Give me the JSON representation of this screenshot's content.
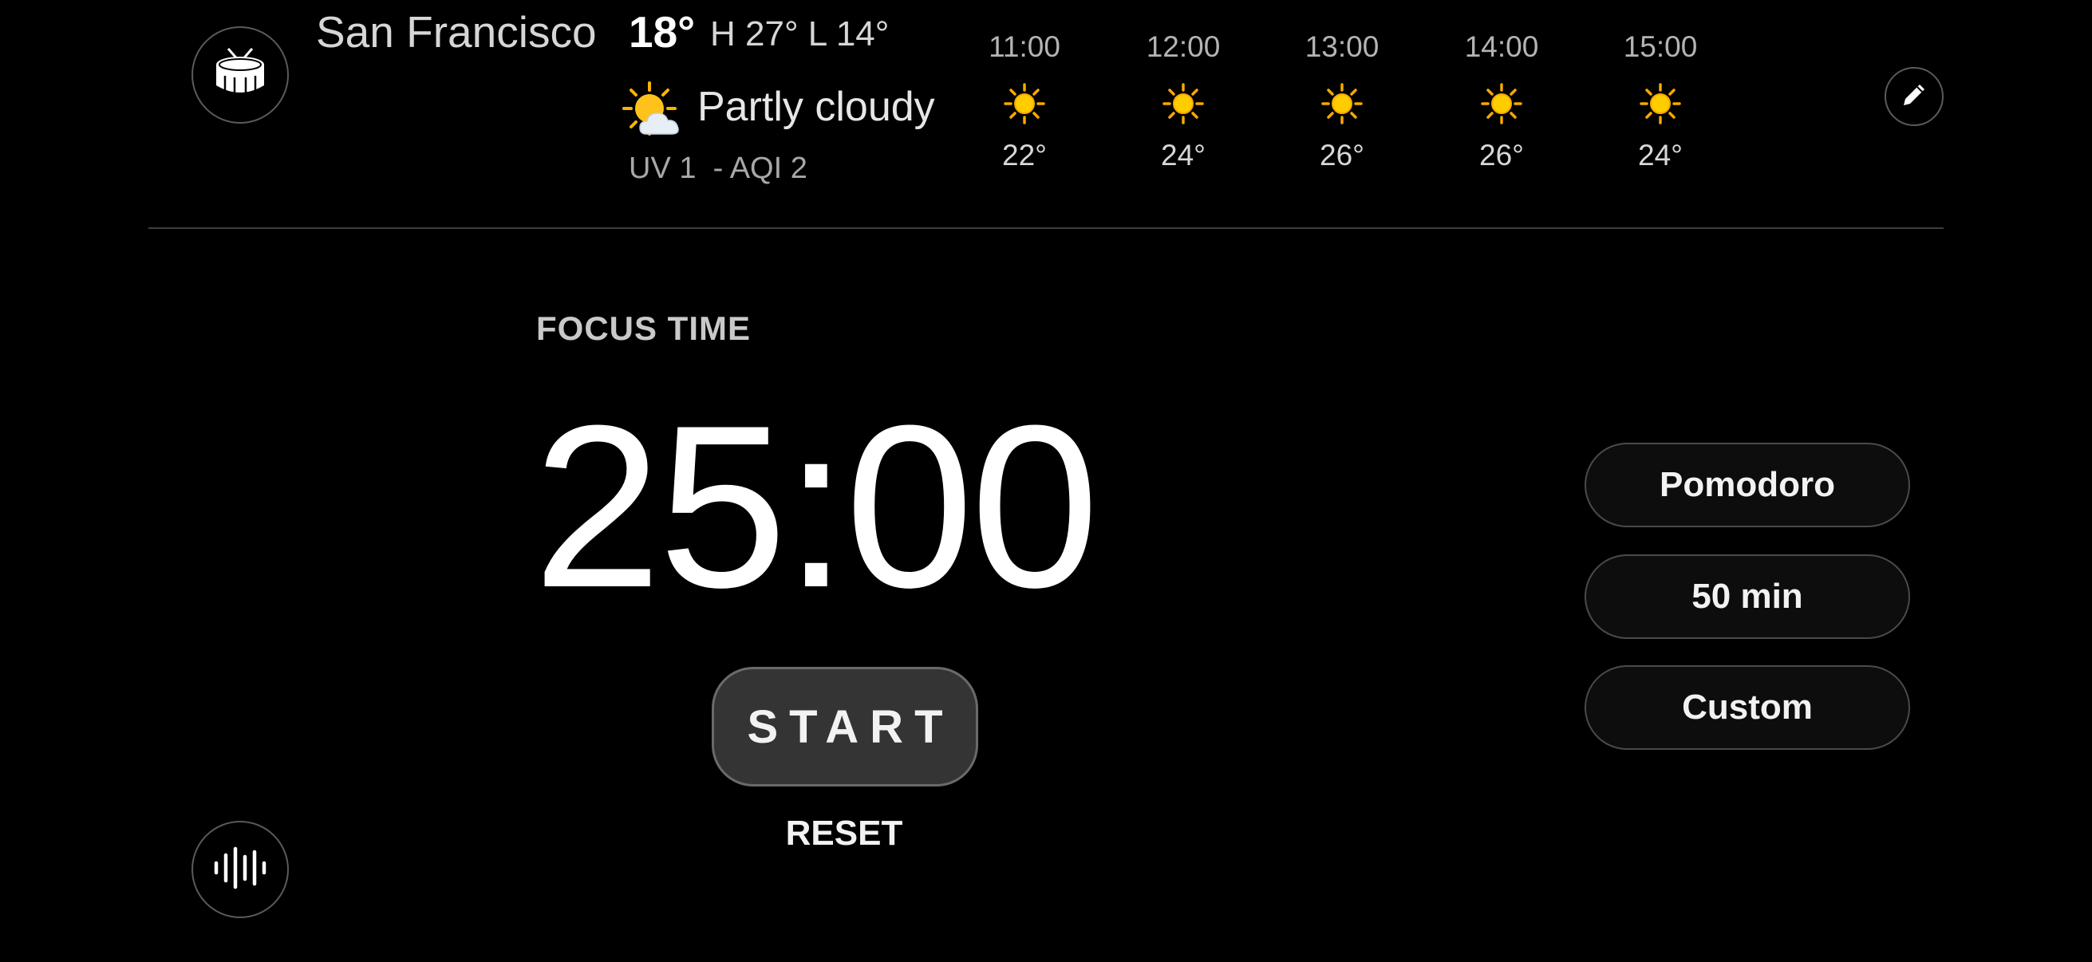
{
  "weather": {
    "city": "San Francisco",
    "temperature": "18°",
    "high_low": "H 27° L 14°",
    "condition": "Partly cloudy",
    "condition_icon": "partly-cloudy-icon",
    "uv_aqi": "UV 1  - AQI 2",
    "hourly": [
      {
        "time": "11:00",
        "icon": "sun-icon",
        "temp": "22°"
      },
      {
        "time": "12:00",
        "icon": "sun-icon",
        "temp": "24°"
      },
      {
        "time": "13:00",
        "icon": "sun-icon",
        "temp": "26°"
      },
      {
        "time": "14:00",
        "icon": "sun-icon",
        "temp": "26°"
      },
      {
        "time": "15:00",
        "icon": "sun-icon",
        "temp": "24°"
      }
    ]
  },
  "focus": {
    "label": "FOCUS TIME",
    "timer": "25:00",
    "start_label": "START",
    "reset_label": "RESET"
  },
  "presets": [
    {
      "label": "Pomodoro"
    },
    {
      "label": "50 min"
    },
    {
      "label": "Custom"
    }
  ],
  "icons": {
    "drum": "drum-icon",
    "sound": "sound-wave-icon",
    "edit": "pencil-icon"
  },
  "colors": {
    "background": "#000000",
    "sun": "#ffcc00",
    "button_fill": "#343434",
    "preset_border": "#4a4a4a"
  }
}
